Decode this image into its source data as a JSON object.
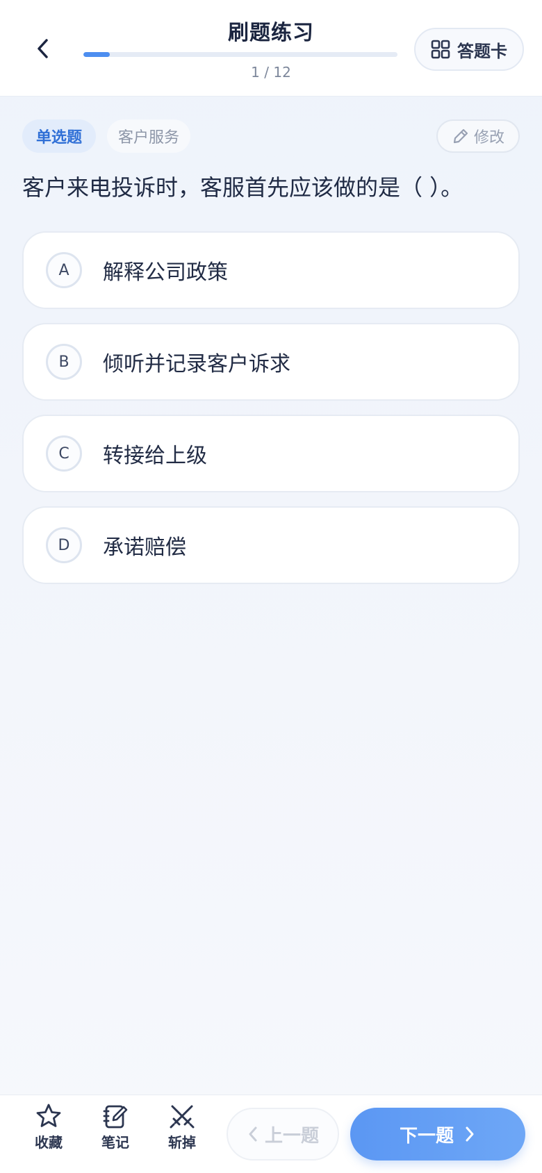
{
  "header": {
    "title": "刷题练习",
    "progress_text": "1 / 12",
    "progress_fraction": 0.083,
    "answer_card_label": "答题卡"
  },
  "question": {
    "type_tag": "单选题",
    "category_tag": "客户服务",
    "edit_label": "修改",
    "text": "客户来电投诉时，客服首先应该做的是（ ）。",
    "options": [
      {
        "letter": "A",
        "text": "解释公司政策"
      },
      {
        "letter": "B",
        "text": "倾听并记录客户诉求"
      },
      {
        "letter": "C",
        "text": "转接给上级"
      },
      {
        "letter": "D",
        "text": "承诺赔偿"
      }
    ]
  },
  "bottom_bar": {
    "favorite_label": "收藏",
    "note_label": "笔记",
    "remove_label": "斩掉",
    "prev_label": "上一题",
    "next_label": "下一题"
  },
  "colors": {
    "accent": "#4d8ef0",
    "tag_bg": "#e2ecfb",
    "tag_text": "#2f6fd6"
  }
}
